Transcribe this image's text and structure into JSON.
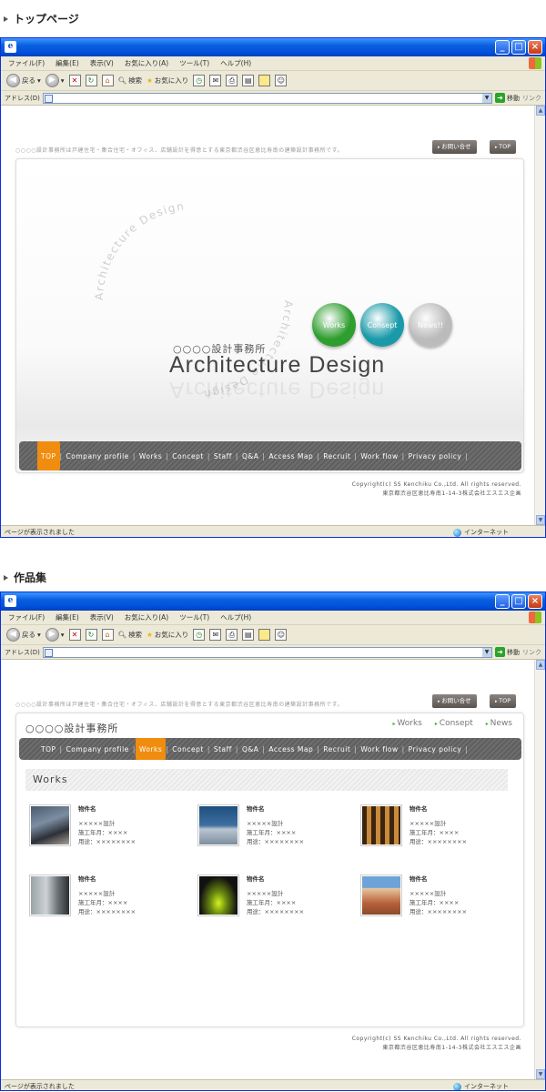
{
  "sections": [
    {
      "title": "トップページ"
    },
    {
      "title": "作品集"
    }
  ],
  "browser": {
    "menu": [
      "ファイル(F)",
      "編集(E)",
      "表示(V)",
      "お気に入り(A)",
      "ツール(T)",
      "ヘルプ(H)"
    ],
    "toolbar": {
      "back": "戻る",
      "search": "検索",
      "favorites": "お気に入り"
    },
    "address_label": "アドレス(D)",
    "go_label": "移動",
    "links_label": "リンク",
    "status_text": "ページが表示されました",
    "zone_text": "インターネット"
  },
  "site": {
    "tagline": "○○○○設計事務所は戸建住宅・集合住宅・オフィス、店舗設計を得意とする東京都渋谷区恵比寿南の建築設計事務所です。",
    "contact_btn": "お問い合せ",
    "top_btn": "TOP",
    "company_small": "○○○○設計事務所",
    "brand": "Architecture Design",
    "ring_text": "Architecture Design",
    "circles": [
      {
        "label": "Works",
        "color": "#2e9e2e"
      },
      {
        "label": "Consept",
        "color": "#1a9aa8"
      },
      {
        "label": "News!!",
        "color": "#bbbbbb"
      }
    ],
    "nav": [
      "TOP",
      "Company profile",
      "Works",
      "Concept",
      "Staff",
      "Q&A",
      "Access Map",
      "Recruit",
      "Work flow",
      "Privacy policy"
    ],
    "copyright": "Copyright(c) SS Kenchiku Co.,Ltd. All rights reserved.",
    "address": "東京都渋谷区恵比寿南1-14-3株式会社エスエス企画"
  },
  "works_page": {
    "header_company": "○○○○設計事務所",
    "header_links": [
      "Works",
      "Consept",
      "News"
    ],
    "heading": "Works",
    "items": [
      {
        "name": "物件名",
        "designer": "×××××設計",
        "year": "施工年月：××××",
        "use": "用途：××××××××"
      },
      {
        "name": "物件名",
        "designer": "×××××設計",
        "year": "施工年月：××××",
        "use": "用途：××××××××"
      },
      {
        "name": "物件名",
        "designer": "×××××設計",
        "year": "施工年月：××××",
        "use": "用途：××××××××"
      },
      {
        "name": "物件名",
        "designer": "×××××設計",
        "year": "施工年月：××××",
        "use": "用途：××××××××"
      },
      {
        "name": "物件名",
        "designer": "×××××設計",
        "year": "施工年月：××××",
        "use": "用途：××××××××"
      },
      {
        "name": "物件名",
        "designer": "×××××設計",
        "year": "施工年月：××××",
        "use": "用途：××××××××"
      }
    ]
  }
}
